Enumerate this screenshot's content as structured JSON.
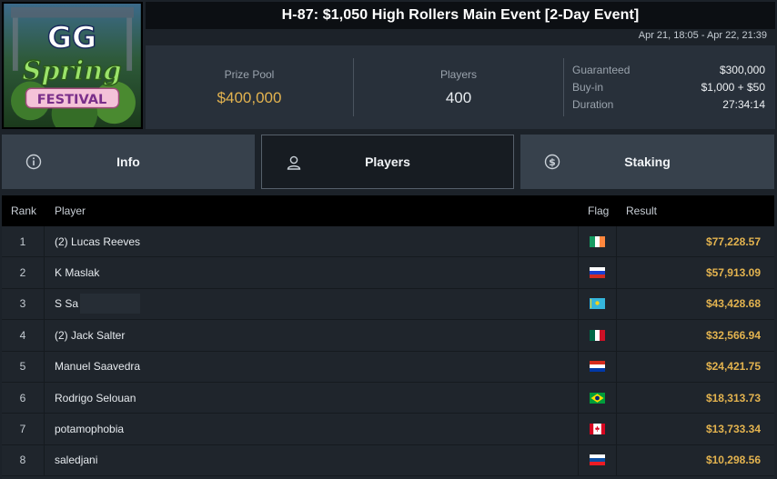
{
  "logo": {
    "line1": "GG",
    "line2": "Spring",
    "line3": "FESTIVAL"
  },
  "event": {
    "title": "H-87: $1,050 High Rollers Main Event [2-Day Event]",
    "date_range": "Apr 21, 18:05 - Apr 22, 21:39"
  },
  "summary": {
    "prize_pool_label": "Prize Pool",
    "prize_pool_value": "$400,000",
    "players_label": "Players",
    "players_value": "400",
    "details": [
      {
        "label": "Guaranteed",
        "value": "$300,000"
      },
      {
        "label": "Buy-in",
        "value": "$1,000 + $50"
      },
      {
        "label": "Duration",
        "value": "27:34:14"
      }
    ]
  },
  "tabs": [
    {
      "label": "Info",
      "icon": "info-icon",
      "active": false
    },
    {
      "label": "Players",
      "icon": "user-icon",
      "active": true
    },
    {
      "label": "Staking",
      "icon": "dollar-coin-icon",
      "active": false
    }
  ],
  "table": {
    "columns": {
      "rank": "Rank",
      "player": "Player",
      "flag": "Flag",
      "result": "Result"
    },
    "rows": [
      {
        "rank": "1",
        "player": "(2) Lucas Reeves",
        "flag": "ireland",
        "result": "$77,228.57"
      },
      {
        "rank": "2",
        "player": "K Maslak",
        "flag": "russia",
        "result": "$57,913.09"
      },
      {
        "rank": "3",
        "player": "S Sa",
        "flag": "kazakhstan",
        "result": "$43,428.68",
        "redacted": true
      },
      {
        "rank": "4",
        "player": "(2) Jack Salter",
        "flag": "mexico",
        "result": "$32,566.94"
      },
      {
        "rank": "5",
        "player": "Manuel Saavedra",
        "flag": "paraguay",
        "result": "$24,421.75"
      },
      {
        "rank": "6",
        "player": "Rodrigo Selouan",
        "flag": "brazil",
        "result": "$18,313.73"
      },
      {
        "rank": "7",
        "player": "potamophobia",
        "flag": "canada",
        "result": "$13,733.34"
      },
      {
        "rank": "8",
        "player": "saledjani",
        "flag": "slovenia",
        "result": "$10,298.56"
      }
    ]
  }
}
